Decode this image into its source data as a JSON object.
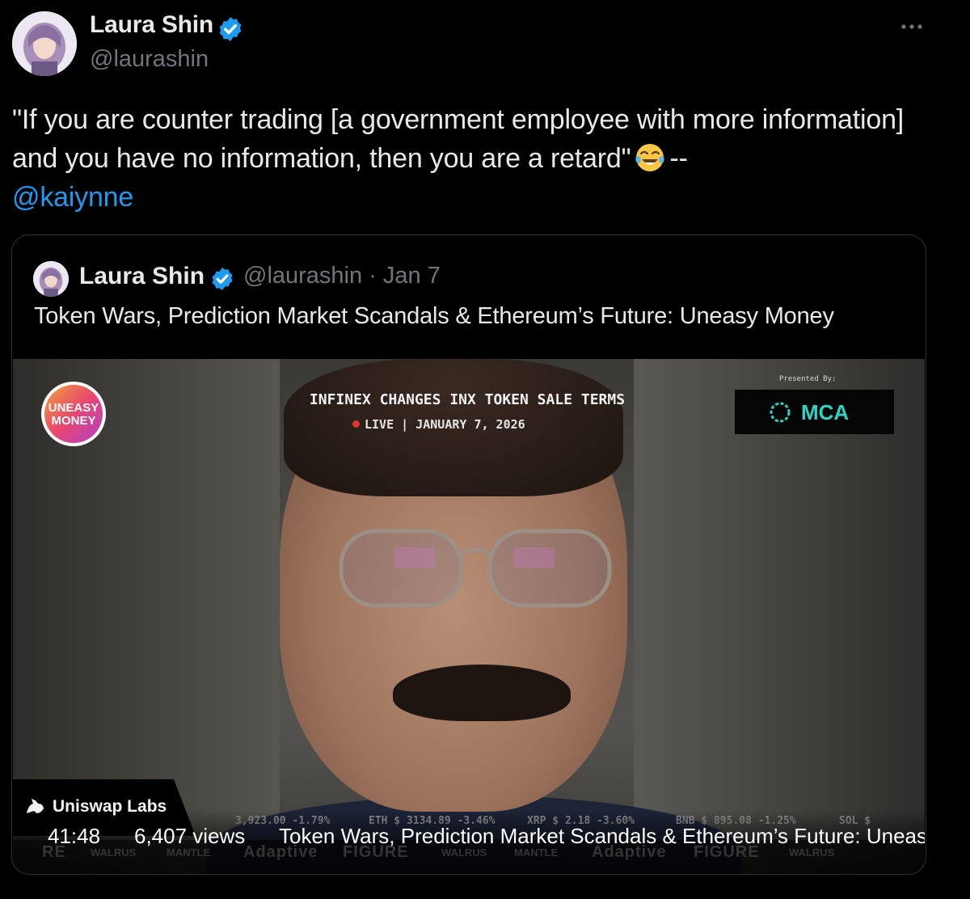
{
  "tweet": {
    "author_name": "Laura Shin",
    "author_handle": "@laurashin",
    "text_before_emoji": "\"If you are counter trading [a government employee with more information] and you have no information, then you are a retard\"",
    "emoji": "face-with-tears-of-joy",
    "text_after_emoji": "--",
    "mention": "@kaiynne",
    "more_icon": "more-horizontal-icon"
  },
  "quote": {
    "author_name": "Laura Shin",
    "meta": "@laurashin · Jan 7",
    "text": "Token Wars, Prediction Market Scandals & Ethereum’s Future: Uneasy Money"
  },
  "video": {
    "show_logo_text": "UNEASY MONEY",
    "headline": "INFINEX CHANGES INX TOKEN SALE TERMS",
    "live_label": "LIVE",
    "date": "JANUARY 7, 2026",
    "presented_by": "Presented By:",
    "sponsor": "MCA",
    "watermark": "Uniswap Labs",
    "ticker": [
      "3,923.00 -1.79%",
      "ETH $ 3134.89 -3.46%",
      "XRP $ 2.18 -3.60%",
      "BNB $ 895.08 -1.25%",
      "SOL $"
    ],
    "sponsor_strip": [
      "RE",
      "WALRUS",
      "MANTLE",
      "Adaptive",
      "FIGURE",
      "WALRUS",
      "MANTLE",
      "Adaptive",
      "FIGURE",
      "WALRUS"
    ],
    "duration": "41:48",
    "views": "6,407 views",
    "title": "Token Wars, Prediction Market Scandals & Ethereum’s Future: Uneasy Money"
  },
  "colors": {
    "background": "#000000",
    "text": "#e7e9ea",
    "secondary": "#71767b",
    "link": "#1d9bf0",
    "verified": "#1d9bf0"
  }
}
